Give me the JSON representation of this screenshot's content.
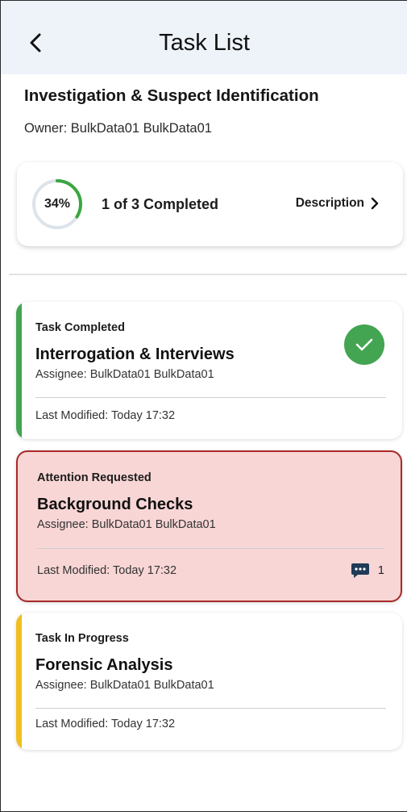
{
  "header": {
    "title": "Task List",
    "back_icon": "chevron-left-icon"
  },
  "plan": {
    "title": "Investigation & Suspect Identification",
    "owner": "Owner: BulkData01 BulkData01"
  },
  "progress": {
    "percent_label": "34%",
    "percent_value": 34,
    "completed_text": "1 of 3 Completed",
    "description_label": "Description",
    "ring_color": "#3aa640",
    "ring_track_color": "#dde3ea"
  },
  "tasks": [
    {
      "status": "Task Completed",
      "name": "Interrogation & Interviews",
      "assignee": "Assignee: BulkData01 BulkData01",
      "modified": "Last Modified: Today 17:32",
      "accent_color": "#43a452",
      "icon": "check-circle-icon"
    },
    {
      "status": "Attention Requested",
      "name": "Background Checks",
      "assignee": "Assignee: BulkData01 BulkData01",
      "modified": "Last Modified: Today 17:32",
      "accent_color": "#a72a2a",
      "comment_icon": "comment-icon",
      "comment_count": "1"
    },
    {
      "status": "Task In Progress",
      "name": "Forensic Analysis",
      "assignee": "Assignee: BulkData01 BulkData01",
      "modified": "Last Modified: Today 17:32",
      "accent_color": "#f0c020"
    }
  ]
}
